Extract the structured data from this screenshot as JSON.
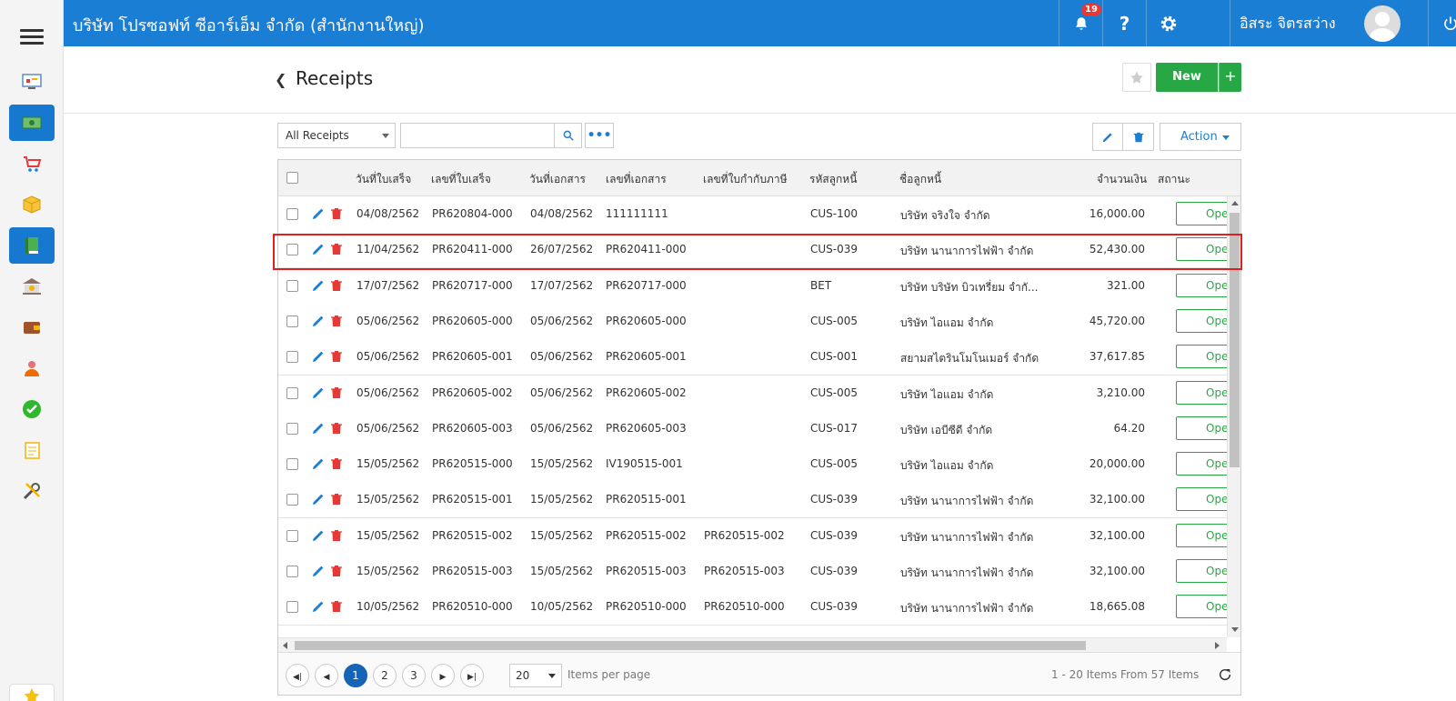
{
  "topbar": {
    "company": "บริษัท โปรซอฟท์ ซีอาร์เอ็ม จำกัด (สำนักงานใหญ่)",
    "notifications_count": "19",
    "user_name": "อิสระ จิตรสว่าง",
    "brand_color": "#1b7ed5"
  },
  "sidebar": {
    "items": [
      {
        "icon": "monitor-dashboard-icon",
        "active": false
      },
      {
        "icon": "money-icon",
        "active": true
      },
      {
        "icon": "cart-icon",
        "active": false
      },
      {
        "icon": "box-icon",
        "active": false
      },
      {
        "icon": "book-icon",
        "active": true
      },
      {
        "icon": "bank-icon",
        "active": false
      },
      {
        "icon": "wallet-icon",
        "active": false
      },
      {
        "icon": "people-icon",
        "active": false
      },
      {
        "icon": "check-circle-icon",
        "active": false
      },
      {
        "icon": "report-icon",
        "active": false
      },
      {
        "icon": "tools-icon",
        "active": false
      }
    ]
  },
  "page": {
    "title": "Receipts",
    "new_label": "New",
    "plus_label": "+"
  },
  "toolbar": {
    "filter_value": "All Receipts",
    "search_placeholder": "",
    "action_label": "Action"
  },
  "table": {
    "headers": {
      "receipt_date": "วันที่ใบเสร็จ",
      "receipt_no": "เลขที่ใบเสร็จ",
      "doc_date": "วันที่เอกสาร",
      "doc_no": "เลขที่เอกสาร",
      "tax_invoice": "เลขที่ใบกำกับภาษี",
      "customer_code": "รหัสลูกหนี้",
      "customer_name": "ชื่อลูกหนี้",
      "amount": "จำนวนเงิน",
      "status": "สถานะ"
    },
    "rows": [
      {
        "receipt_date": "04/08/2562",
        "receipt_no": "PR620804-000",
        "doc_date": "04/08/2562",
        "doc_no": "111111111",
        "tax_invoice": "",
        "customer_code": "CUS-100",
        "customer_name": "บริษัท จริงใจ จำกัด",
        "amount": "16,000.00",
        "status": "Ope"
      },
      {
        "receipt_date": "11/04/2562",
        "receipt_no": "PR620411-000",
        "doc_date": "26/07/2562",
        "doc_no": "PR620411-000",
        "tax_invoice": "",
        "customer_code": "CUS-039",
        "customer_name": "บริษัท นานาการไฟฟ้า จำกัด",
        "amount": "52,430.00",
        "status": "Ope"
      },
      {
        "receipt_date": "17/07/2562",
        "receipt_no": "PR620717-000",
        "doc_date": "17/07/2562",
        "doc_no": "PR620717-000",
        "tax_invoice": "",
        "customer_code": "BET",
        "customer_name": "บริษัท บริษัท บิวเทรี่ยม จำกั...",
        "amount": "321.00",
        "status": "Ope"
      },
      {
        "receipt_date": "05/06/2562",
        "receipt_no": "PR620605-000",
        "doc_date": "05/06/2562",
        "doc_no": "PR620605-000",
        "tax_invoice": "",
        "customer_code": "CUS-005",
        "customer_name": "บริษัท ไอแอม จำกัด",
        "amount": "45,720.00",
        "status": "Ope"
      },
      {
        "receipt_date": "05/06/2562",
        "receipt_no": "PR620605-001",
        "doc_date": "05/06/2562",
        "doc_no": "PR620605-001",
        "tax_invoice": "",
        "customer_code": "CUS-001",
        "customer_name": "สยามสไตรินโมโนเมอร์ จำกัด",
        "amount": "37,617.85",
        "status": "Ope"
      },
      {
        "receipt_date": "05/06/2562",
        "receipt_no": "PR620605-002",
        "doc_date": "05/06/2562",
        "doc_no": "PR620605-002",
        "tax_invoice": "",
        "customer_code": "CUS-005",
        "customer_name": "บริษัท ไอแอม จำกัด",
        "amount": "3,210.00",
        "status": "Ope"
      },
      {
        "receipt_date": "05/06/2562",
        "receipt_no": "PR620605-003",
        "doc_date": "05/06/2562",
        "doc_no": "PR620605-003",
        "tax_invoice": "",
        "customer_code": "CUS-017",
        "customer_name": "บริษัท เอบีซีดี จำกัด",
        "amount": "64.20",
        "status": "Ope"
      },
      {
        "receipt_date": "15/05/2562",
        "receipt_no": "PR620515-000",
        "doc_date": "15/05/2562",
        "doc_no": "IV190515-001",
        "tax_invoice": "",
        "customer_code": "CUS-005",
        "customer_name": "บริษัท ไอแอม จำกัด",
        "amount": "20,000.00",
        "status": "Ope"
      },
      {
        "receipt_date": "15/05/2562",
        "receipt_no": "PR620515-001",
        "doc_date": "15/05/2562",
        "doc_no": "PR620515-001",
        "tax_invoice": "",
        "customer_code": "CUS-039",
        "customer_name": "บริษัท นานาการไฟฟ้า จำกัด",
        "amount": "32,100.00",
        "status": "Ope"
      },
      {
        "receipt_date": "15/05/2562",
        "receipt_no": "PR620515-002",
        "doc_date": "15/05/2562",
        "doc_no": "PR620515-002",
        "tax_invoice": "PR620515-002",
        "customer_code": "CUS-039",
        "customer_name": "บริษัท นานาการไฟฟ้า จำกัด",
        "amount": "32,100.00",
        "status": "Ope"
      },
      {
        "receipt_date": "15/05/2562",
        "receipt_no": "PR620515-003",
        "doc_date": "15/05/2562",
        "doc_no": "PR620515-003",
        "tax_invoice": "PR620515-003",
        "customer_code": "CUS-039",
        "customer_name": "บริษัท นานาการไฟฟ้า จำกัด",
        "amount": "32,100.00",
        "status": "Ope"
      },
      {
        "receipt_date": "10/05/2562",
        "receipt_no": "PR620510-000",
        "doc_date": "10/05/2562",
        "doc_no": "PR620510-000",
        "tax_invoice": "PR620510-000",
        "customer_code": "CUS-039",
        "customer_name": "บริษัท นานาการไฟฟ้า จำกัด",
        "amount": "18,665.08",
        "status": "Ope"
      }
    ]
  },
  "pager": {
    "pages": [
      "1",
      "2",
      "3"
    ],
    "current_page": "1",
    "page_size": "20",
    "items_per_page_label": "Items per page",
    "info": "1 - 20 Items From 57 Items"
  }
}
